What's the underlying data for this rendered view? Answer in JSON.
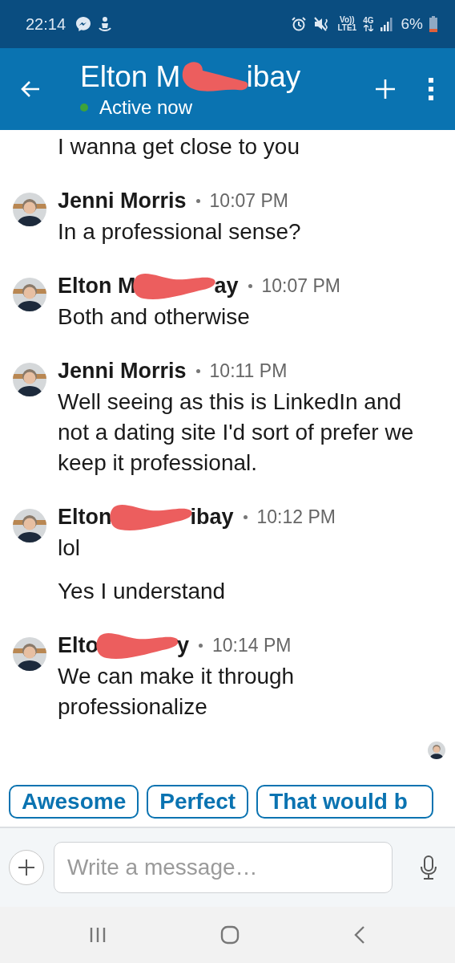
{
  "status_bar": {
    "time": "22:14",
    "volte": "Vo))",
    "lte": "LTE1",
    "network": "4G",
    "battery": "6%"
  },
  "header": {
    "name_start": "Elton M",
    "name_end": "ibay",
    "redacted": true,
    "presence": "Active now",
    "online": true
  },
  "messages": [
    {
      "kind": "continuation",
      "texts": [
        "I wanna get close to you"
      ]
    },
    {
      "kind": "group",
      "name_start": "Jenni Morris",
      "redacted": false,
      "time": "10:07 PM",
      "texts": [
        "In a professional sense?"
      ]
    },
    {
      "kind": "group",
      "name_start": "Elton M",
      "name_end": "ay",
      "redacted": true,
      "time": "10:07 PM",
      "texts": [
        "Both and otherwise"
      ]
    },
    {
      "kind": "group",
      "name_start": "Jenni Morris",
      "redacted": false,
      "time": "10:11 PM",
      "texts": [
        "Well seeing as this is LinkedIn and not a dating site I'd sort of prefer we keep it professional."
      ]
    },
    {
      "kind": "group",
      "name_start": "Elton",
      "name_end": "ibay",
      "redacted": true,
      "time": "10:12 PM",
      "texts": [
        "lol",
        "Yes I understand"
      ]
    },
    {
      "kind": "group",
      "name_start": "Elto",
      "name_end": "y",
      "redacted": true,
      "time": "10:14 PM",
      "texts": [
        "We can make it through professionalize"
      ]
    }
  ],
  "suggestions": [
    "Awesome",
    "Perfect",
    "That would b"
  ],
  "composer": {
    "placeholder": "Write a message…"
  }
}
